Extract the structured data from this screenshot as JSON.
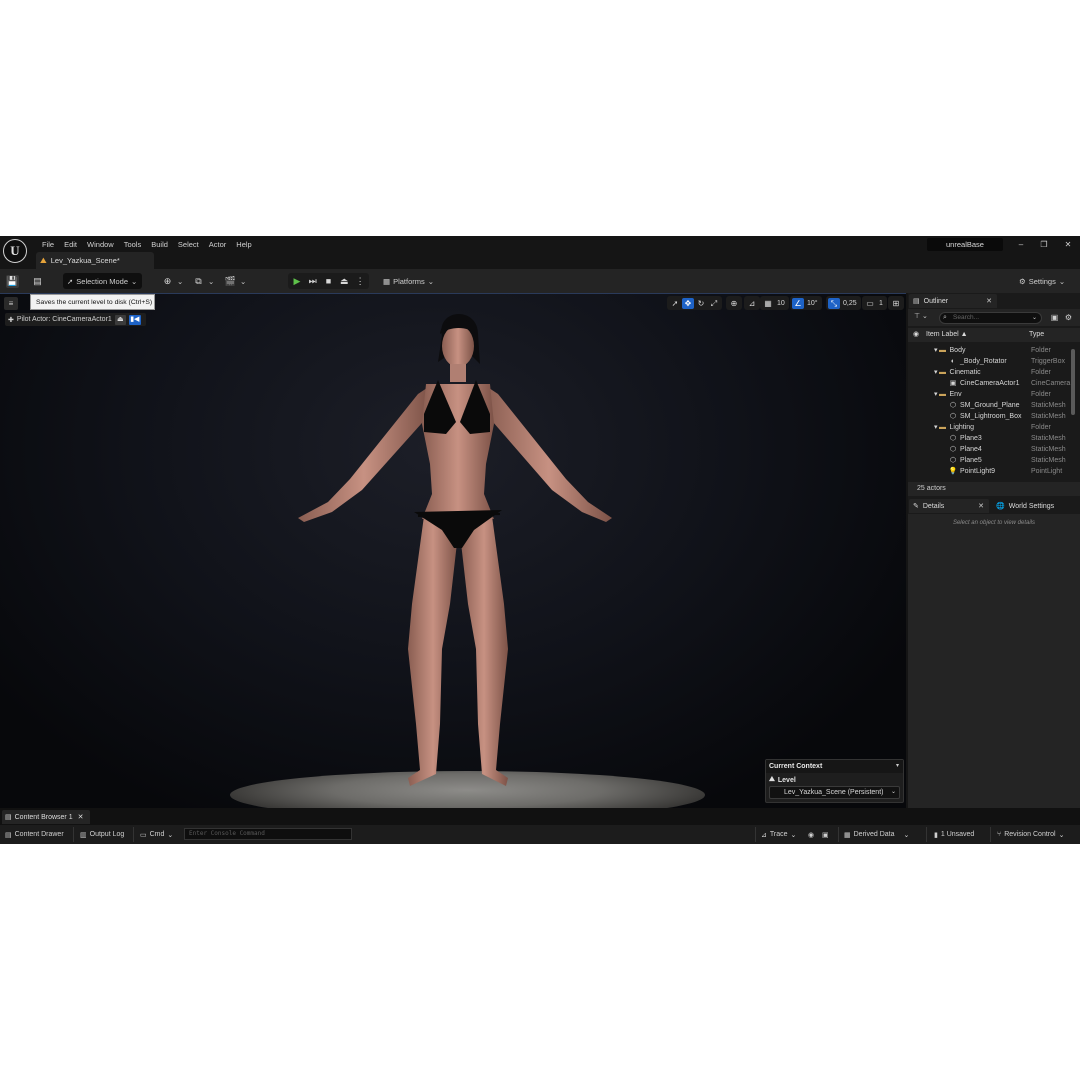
{
  "menu": [
    "File",
    "Edit",
    "Window",
    "Tools",
    "Build",
    "Select",
    "Actor",
    "Help"
  ],
  "document_tab": "Lev_Yazkua_Scene*",
  "project_name": "unrealBase",
  "toolbar": {
    "selection_mode": "Selection Mode",
    "platforms": "Platforms",
    "settings": "Settings",
    "tooltip": "Saves the current level to disk (Ctrl+S)"
  },
  "viewport": {
    "pilot_actor": "Pilot Actor: CineCameraActor1",
    "grid_snap": "10",
    "rotation_snap": "10°",
    "scale_snap": "0,25",
    "camera_speed": "1",
    "current_context_title": "Current Context",
    "level_label": "Level",
    "level_value": "Lev_Yazkua_Scene (Persistent)"
  },
  "outliner": {
    "tab_label": "Outliner",
    "search_placeholder": "Search...",
    "col_label": "Item Label ▲",
    "col_type": "Type",
    "rows": [
      {
        "label": "Body",
        "type": "Folder",
        "icon": "folder-icon",
        "indent": 1,
        "expanded": true
      },
      {
        "label": "_Body_Rotator",
        "type": "TriggerBox",
        "icon": "trigger-icon",
        "indent": 2
      },
      {
        "label": "Cinematic",
        "type": "Folder",
        "icon": "folder-icon",
        "indent": 1,
        "expanded": true
      },
      {
        "label": "CineCameraActor1",
        "type": "CineCamera",
        "icon": "camera-icon",
        "indent": 2
      },
      {
        "label": "Env",
        "type": "Folder",
        "icon": "folder-icon",
        "indent": 1,
        "expanded": true
      },
      {
        "label": "SM_Ground_Plane",
        "type": "StaticMesh",
        "icon": "mesh-icon",
        "indent": 2
      },
      {
        "label": "SM_Lightroom_Box",
        "type": "StaticMesh",
        "icon": "mesh-icon",
        "indent": 2
      },
      {
        "label": "Lighting",
        "type": "Folder",
        "icon": "folder-icon",
        "indent": 1,
        "expanded": true
      },
      {
        "label": "Plane3",
        "type": "StaticMesh",
        "icon": "mesh-icon",
        "indent": 2
      },
      {
        "label": "Plane4",
        "type": "StaticMesh",
        "icon": "mesh-icon",
        "indent": 2
      },
      {
        "label": "Plane5",
        "type": "StaticMesh",
        "icon": "mesh-icon",
        "indent": 2
      },
      {
        "label": "PointLight9",
        "type": "PointLight",
        "icon": "light-icon",
        "indent": 2
      }
    ],
    "actor_count": "25 actors"
  },
  "details": {
    "tab_label": "Details",
    "world_settings_label": "World Settings",
    "empty_hint": "Select an object to view details"
  },
  "bottom": {
    "content_browser_tab": "Content Browser 1",
    "content_drawer": "Content Drawer",
    "output_log": "Output Log",
    "cmd": "Cmd",
    "console_placeholder": "Enter Console Command",
    "trace": "Trace",
    "derived_data": "Derived Data",
    "unsaved": "1 Unsaved",
    "revision_control": "Revision Control"
  },
  "colors": {
    "accent": "#1e63c7",
    "play_green": "#5ec24a",
    "folder": "#caa35a"
  }
}
